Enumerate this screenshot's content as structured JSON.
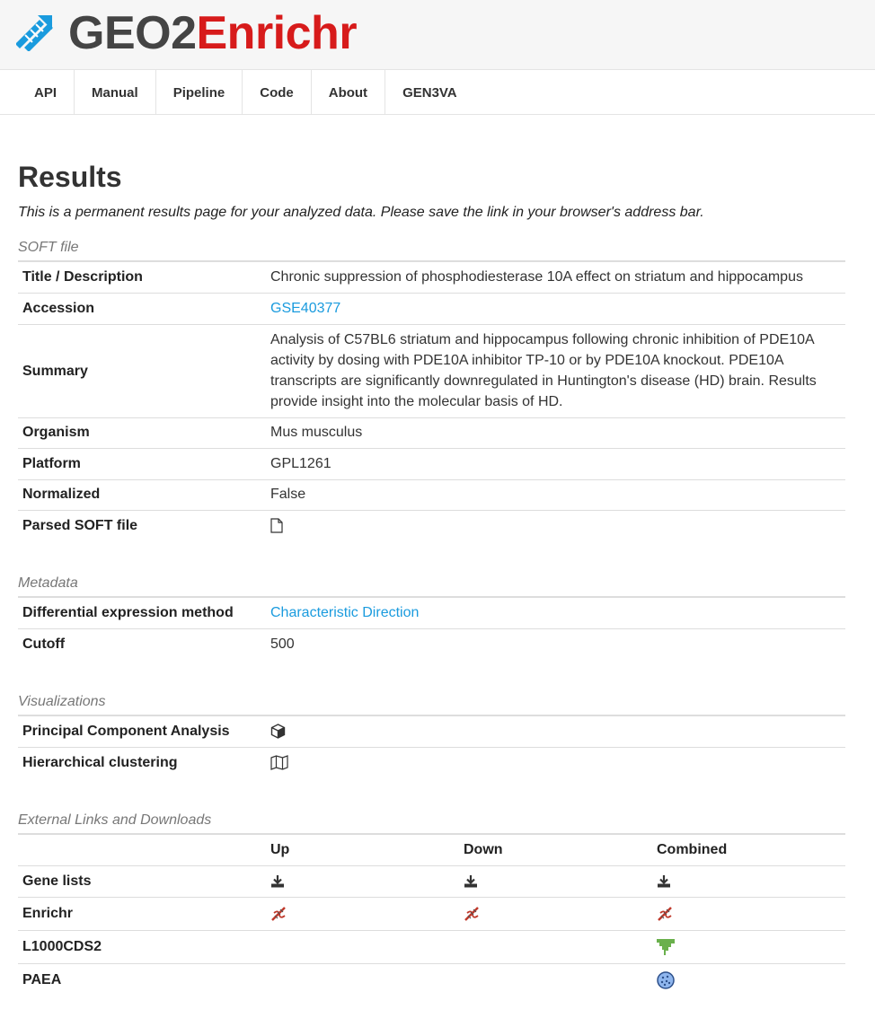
{
  "brand": {
    "part1": "GEO2",
    "part2": "Enrichr",
    "accent": "#d71b1b",
    "icon": "dna-icon"
  },
  "nav": [
    "API",
    "Manual",
    "Pipeline",
    "Code",
    "About",
    "GEN3VA"
  ],
  "page": {
    "title": "Results",
    "intro": "This is a permanent results page for your analyzed data. Please save the link in your browser's address bar."
  },
  "soft": {
    "label": "SOFT file",
    "rows": [
      {
        "key": "Title / Description",
        "value": "Chronic suppression of phosphodiesterase 10A effect on striatum and hippocampus"
      },
      {
        "key": "Accession",
        "value": "GSE40377"
      },
      {
        "key": "Summary",
        "value": "Analysis of C57BL6 striatum and hippocampus following chronic inhibition of PDE10A activity by dosing with PDE10A inhibitor TP-10 or by PDE10A knockout. PDE10A transcripts are significantly downregulated in Huntington's disease (HD) brain. Results provide insight into the molecular basis of HD."
      },
      {
        "key": "Organism",
        "value": "Mus musculus"
      },
      {
        "key": "Platform",
        "value": "GPL1261"
      },
      {
        "key": "Normalized",
        "value": "False"
      },
      {
        "key": "Parsed SOFT file",
        "icon": "file-icon"
      }
    ]
  },
  "metadata": {
    "label": "Metadata",
    "rows": [
      {
        "key": "Differential expression method",
        "value": "Characteristic Direction"
      },
      {
        "key": "Cutoff",
        "value": "500"
      }
    ]
  },
  "viz": {
    "label": "Visualizations",
    "rows": [
      {
        "key": "Principal Component Analysis",
        "icon": "cube-icon"
      },
      {
        "key": "Hierarchical clustering",
        "icon": "map-icon"
      }
    ]
  },
  "external": {
    "label": "External Links and Downloads",
    "columns": [
      "Up",
      "Down",
      "Combined"
    ],
    "rows": [
      "Gene lists",
      "Enrichr",
      "L1000CDS2",
      "PAEA"
    ]
  },
  "colors": {
    "link": "#1a9bde",
    "enrichr_icon": "#c0392b",
    "l1000_icon": "#6ab04c",
    "paea_icon": "#3a7bd5"
  }
}
